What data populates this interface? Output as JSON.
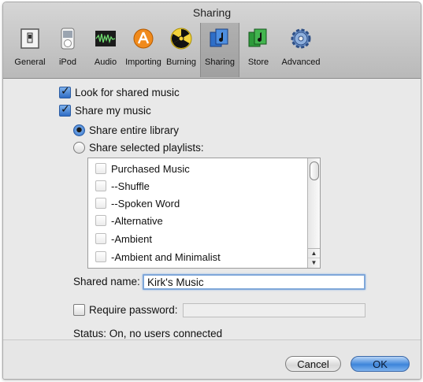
{
  "window": {
    "title": "Sharing"
  },
  "toolbar": {
    "items": [
      {
        "label": "General",
        "icon": "switch-icon"
      },
      {
        "label": "iPod",
        "icon": "ipod-icon"
      },
      {
        "label": "Audio",
        "icon": "waveform-icon"
      },
      {
        "label": "Importing",
        "icon": "import-icon"
      },
      {
        "label": "Burning",
        "icon": "radiation-icon"
      },
      {
        "label": "Sharing",
        "icon": "sharing-icon",
        "active": true
      },
      {
        "label": "Store",
        "icon": "store-icon"
      },
      {
        "label": "Advanced",
        "icon": "gear-icon"
      }
    ]
  },
  "options": {
    "look_for_shared": {
      "label": "Look for shared music",
      "checked": true
    },
    "share_my_music": {
      "label": "Share my music",
      "checked": true
    },
    "share_entire": {
      "label": "Share entire library",
      "selected": true
    },
    "share_selected": {
      "label": "Share selected playlists:",
      "selected": false
    }
  },
  "playlists": [
    "Purchased Music",
    "--Shuffle",
    "--Spoken Word",
    "-Alternative",
    "-Ambient",
    "-Ambient and Minimalist"
  ],
  "shared_name": {
    "label": "Shared name:",
    "value": "Kirk's Music"
  },
  "require_password": {
    "label": "Require password:",
    "checked": false
  },
  "status": {
    "text": "Status: On, no users connected"
  },
  "buttons": {
    "cancel": "Cancel",
    "ok": "OK"
  },
  "colors": {
    "accent": "#3d85da",
    "toolbar_bg": "#c4c4c4",
    "window_bg": "#e9e9e9"
  }
}
